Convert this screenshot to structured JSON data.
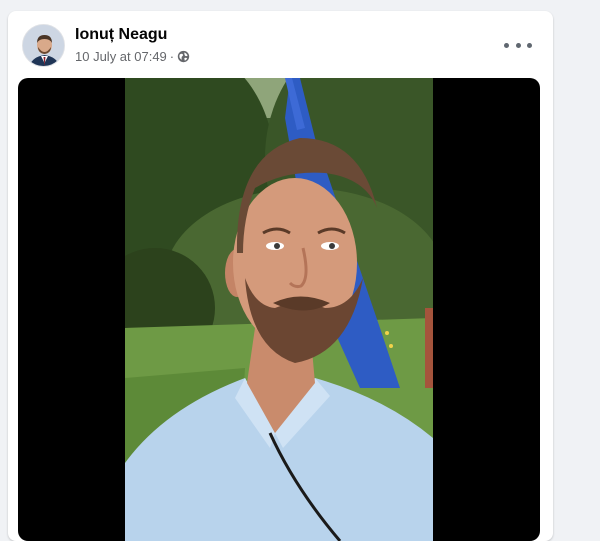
{
  "post": {
    "author": "Ionuț Neagu",
    "timestamp": "10 July at 07:49",
    "separator": "·",
    "privacy_icon": "globe-icon",
    "more_icon": "more-options-icon",
    "media_type": "video"
  },
  "colors": {
    "page_bg": "#f0f2f5",
    "card_bg": "#ffffff",
    "name": "#050505",
    "meta": "#65676b",
    "media_bg": "#000000"
  }
}
